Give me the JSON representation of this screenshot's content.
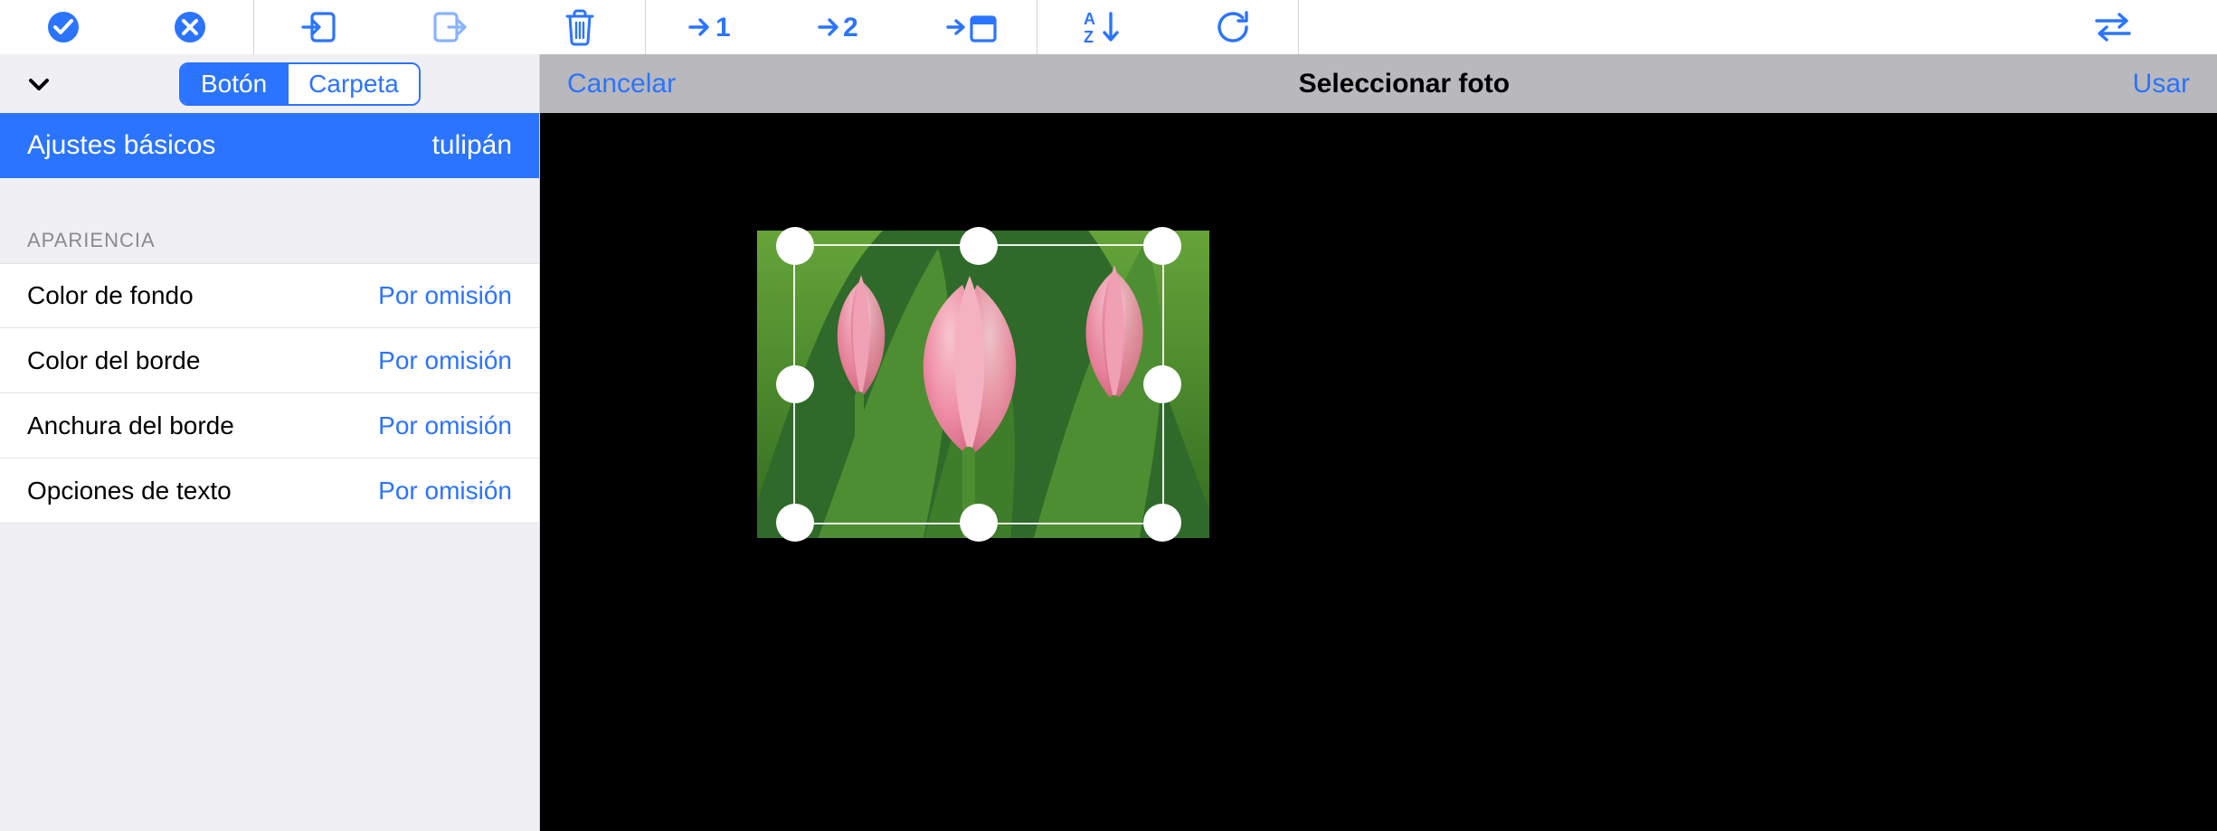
{
  "toolbar": {
    "icons": [
      "check-circle-icon",
      "x-circle-icon",
      "import-icon",
      "export-icon",
      "trash-icon",
      "goto-1-icon",
      "goto-2-icon",
      "goto-home-icon",
      "sort-az-icon",
      "refresh-icon",
      "swap-icon"
    ]
  },
  "left": {
    "segmented": {
      "button": "Botón",
      "folder": "Carpeta",
      "active": "button"
    },
    "selected": {
      "label": "Ajustes básicos",
      "value": "tulipán"
    },
    "section_header": "APARIENCIA",
    "rows": [
      {
        "label": "Color de fondo",
        "value": "Por omisión"
      },
      {
        "label": "Color del borde",
        "value": "Por omisión"
      },
      {
        "label": "Anchura del borde",
        "value": "Por omisión"
      },
      {
        "label": "Opciones de texto",
        "value": "Por omisión"
      }
    ]
  },
  "picker": {
    "cancel": "Cancelar",
    "title": "Seleccionar foto",
    "use": "Usar"
  },
  "colors": {
    "accent": "#2b74ff",
    "header_bg": "#b9b8bc",
    "panel_bg": "#efeff4"
  }
}
